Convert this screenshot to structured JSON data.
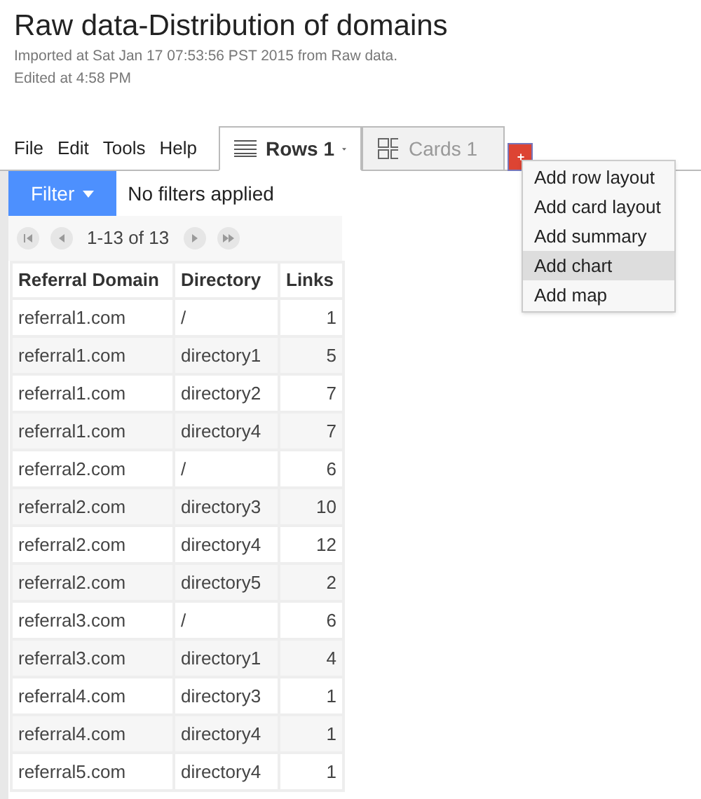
{
  "title": "Raw data-Distribution of domains",
  "subtitle_lines": [
    "Imported at Sat Jan 17 07:53:56 PST 2015 from Raw data.",
    "Edited at 4:58 PM"
  ],
  "menu": [
    "File",
    "Edit",
    "Tools",
    "Help"
  ],
  "tabs": [
    {
      "label": "Rows 1",
      "kind": "rows",
      "selected": true
    },
    {
      "label": "Cards 1",
      "kind": "cards",
      "selected": false
    }
  ],
  "add_button": "+",
  "add_menu": [
    {
      "label": "Add row layout",
      "selected": false
    },
    {
      "label": "Add card layout",
      "selected": false
    },
    {
      "label": "Add summary",
      "selected": false
    },
    {
      "label": "Add chart",
      "selected": true
    },
    {
      "label": "Add map",
      "selected": false
    }
  ],
  "filter": {
    "button": "Filter",
    "status": "No filters applied"
  },
  "pager": "1-13 of 13",
  "table": {
    "columns": [
      "Referral Domain",
      "Directory",
      "Links"
    ],
    "rows": [
      [
        "referral1.com",
        "/",
        "1"
      ],
      [
        "referral1.com",
        "directory1",
        "5"
      ],
      [
        "referral1.com",
        "directory2",
        "7"
      ],
      [
        "referral1.com",
        "directory4",
        "7"
      ],
      [
        "referral2.com",
        "/",
        "6"
      ],
      [
        "referral2.com",
        "directory3",
        "10"
      ],
      [
        "referral2.com",
        "directory4",
        "12"
      ],
      [
        "referral2.com",
        "directory5",
        "2"
      ],
      [
        "referral3.com",
        "/",
        "6"
      ],
      [
        "referral3.com",
        "directory1",
        "4"
      ],
      [
        "referral4.com",
        "directory3",
        "1"
      ],
      [
        "referral4.com",
        "directory4",
        "1"
      ],
      [
        "referral5.com",
        "directory4",
        "1"
      ]
    ]
  }
}
